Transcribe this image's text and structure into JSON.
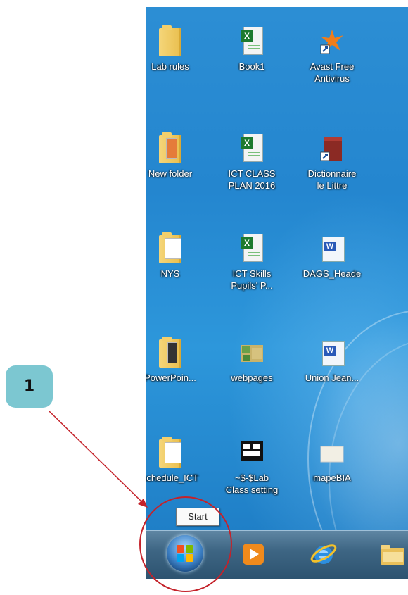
{
  "desktop": {
    "icons": [
      {
        "label": "Lab rules",
        "type": "folder-icon"
      },
      {
        "label": "Book1",
        "type": "excel-file-icon"
      },
      {
        "label": "Avast Free\nAntivirus",
        "type": "avast-shortcut-icon"
      },
      {
        "label": "New folder",
        "type": "folder-icon"
      },
      {
        "label": "ICT CLASS\nPLAN 2016",
        "type": "excel-file-icon"
      },
      {
        "label": "Dictionnaire\nle Littre",
        "type": "book-shortcut-icon"
      },
      {
        "label": "NYS",
        "type": "folder-icon"
      },
      {
        "label": "ICT Skills\nPupils' P...",
        "type": "excel-file-icon"
      },
      {
        "label": "DAGS_Heade",
        "type": "word-file-icon"
      },
      {
        "label": "PowerPoin...",
        "type": "folder-icon"
      },
      {
        "label": "webpages",
        "type": "image-file-icon"
      },
      {
        "label": "Union Jean...",
        "type": "word-file-icon"
      },
      {
        "label": "schedule_ICT",
        "type": "folder-icon"
      },
      {
        "label": "~$-$Lab\nClass setting",
        "type": "temp-file-icon"
      },
      {
        "label": "mapeBIA",
        "type": "map-file-icon"
      }
    ]
  },
  "tooltip": {
    "text": "Start"
  },
  "taskbar": {
    "items": [
      {
        "name": "start-button",
        "icon": "windows-flag-icon"
      },
      {
        "name": "media-player-button",
        "icon": "media-player-icon"
      },
      {
        "name": "internet-explorer-button",
        "icon": "internet-explorer-icon"
      },
      {
        "name": "file-explorer-button",
        "icon": "folder-icon"
      }
    ]
  },
  "annotation": {
    "step_number": "1",
    "color": "#c4222a",
    "badge_color": "#7cc7d1"
  }
}
